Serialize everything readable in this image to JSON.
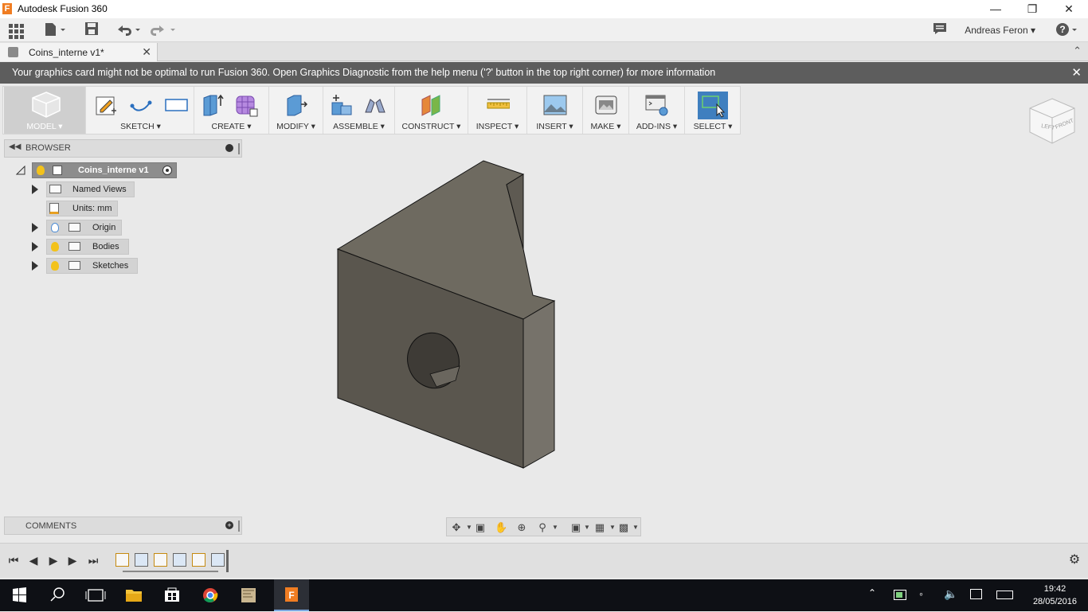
{
  "window": {
    "title": "Autodesk Fusion 360",
    "app_icon_letter": "F"
  },
  "quickbar": {
    "user": "Andreas Feron",
    "help": "?"
  },
  "document_tab": {
    "label": "Coins_interne v1*"
  },
  "banner": {
    "message": "Your graphics card might not be optimal to run Fusion 360. Open Graphics Diagnostic from the help menu ('?' button in the top right corner) for more information"
  },
  "ribbon": {
    "groups": [
      {
        "label": "MODEL ▾"
      },
      {
        "label": "SKETCH ▾"
      },
      {
        "label": "CREATE ▾"
      },
      {
        "label": "MODIFY ▾"
      },
      {
        "label": "ASSEMBLE ▾"
      },
      {
        "label": "CONSTRUCT ▾"
      },
      {
        "label": "INSPECT ▾"
      },
      {
        "label": "INSERT ▾"
      },
      {
        "label": "MAKE ▾"
      },
      {
        "label": "ADD-INS ▾"
      },
      {
        "label": "SELECT ▾"
      }
    ]
  },
  "viewcube": {
    "left": "LEFT",
    "front": "FRONT"
  },
  "browser": {
    "title": "BROWSER",
    "root": "Coins_interne v1",
    "items": [
      {
        "label": "Named Views"
      },
      {
        "label": "Units: mm"
      },
      {
        "label": "Origin"
      },
      {
        "label": "Bodies"
      },
      {
        "label": "Sketches"
      }
    ]
  },
  "comments": {
    "title": "COMMENTS"
  },
  "taskbar": {
    "time": "19:42",
    "date": "28/05/2016"
  },
  "colors": {
    "banner": "#5d5d5d",
    "model_face_front": "#5a564e",
    "model_face_top": "#6e6a60",
    "model_face_side": "#76726a",
    "select_active": "#3f7fbf",
    "taskbar": "#0e1015"
  }
}
